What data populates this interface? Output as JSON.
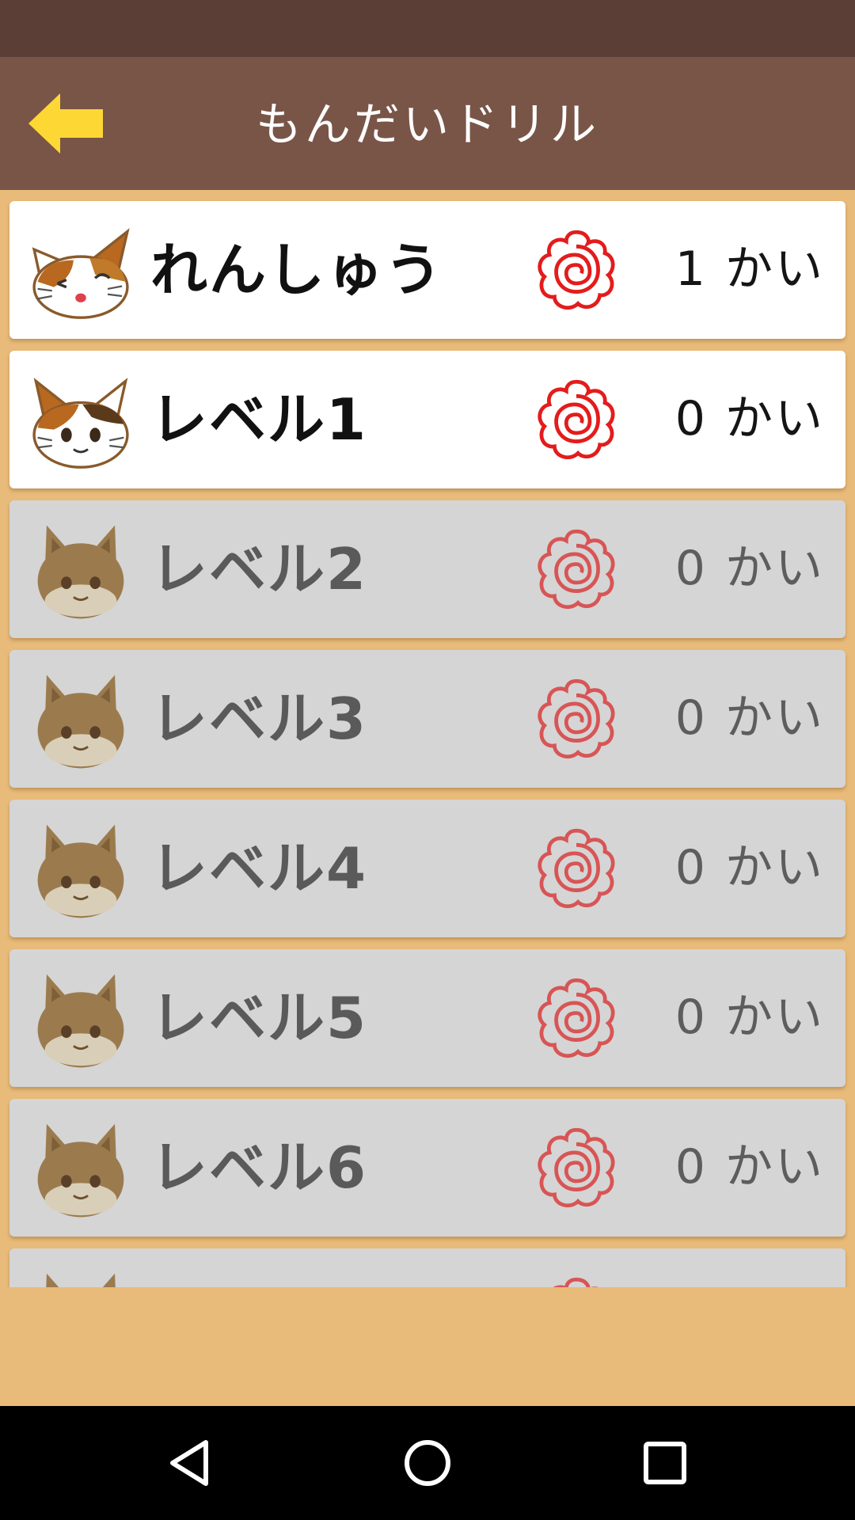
{
  "app_bar": {
    "title": "もんだいドリル",
    "back_icon": "arrow-left-icon",
    "accent_color": "#fdd835"
  },
  "rows": [
    {
      "label": "れんしゅう",
      "count": "1 かい",
      "locked": false,
      "icon": "calico-cat-wink-icon"
    },
    {
      "label": "レベル1",
      "count": "0 かい",
      "locked": false,
      "icon": "calico-cat-icon"
    },
    {
      "label": "レベル2",
      "count": "0 かい",
      "locked": true,
      "icon": "brown-cat-icon"
    },
    {
      "label": "レベル3",
      "count": "0 かい",
      "locked": true,
      "icon": "brown-cat-icon"
    },
    {
      "label": "レベル4",
      "count": "0 かい",
      "locked": true,
      "icon": "brown-cat-icon"
    },
    {
      "label": "レベル5",
      "count": "0 かい",
      "locked": true,
      "icon": "brown-cat-icon"
    },
    {
      "label": "レベル6",
      "count": "0 かい",
      "locked": true,
      "icon": "brown-cat-icon"
    },
    {
      "label": "",
      "count": "",
      "locked": true,
      "icon": "brown-cat-icon"
    }
  ],
  "rose_icon": "red-rose-icon",
  "nav": {
    "back": "triangle-back-icon",
    "home": "circle-home-icon",
    "recents": "square-recents-icon"
  }
}
